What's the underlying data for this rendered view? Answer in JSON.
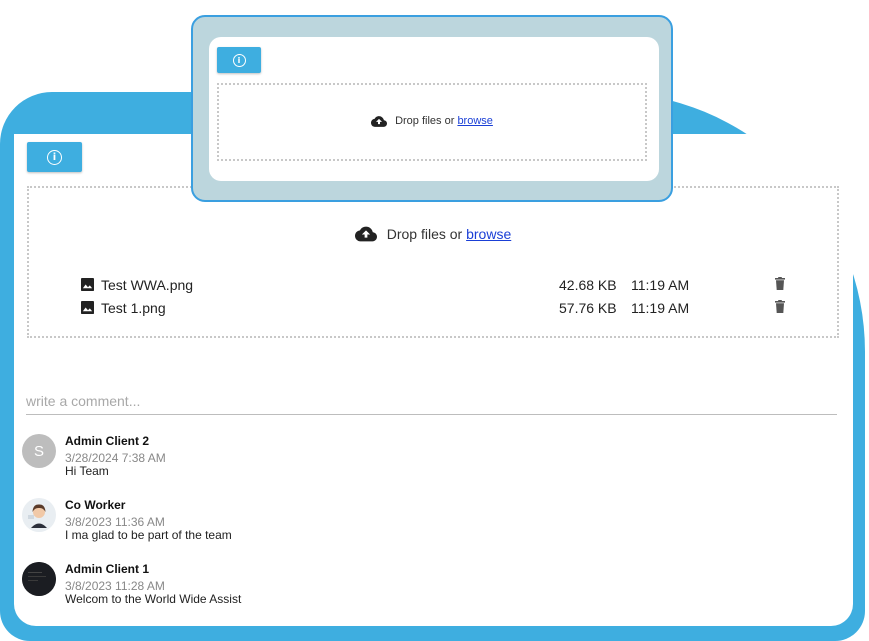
{
  "colors": {
    "accent": "#3eaee0",
    "link": "#1a3fd6",
    "zoom_border": "#3a9fe0"
  },
  "upload": {
    "info_icon": "info-icon",
    "drop_text": "Drop files or",
    "browse_label": "browse",
    "files": [
      {
        "name": "Test WWA.png",
        "size": "42.68 KB",
        "time": "11:19 AM"
      },
      {
        "name": "Test 1.png",
        "size": "57.76 KB",
        "time": "11:19 AM"
      }
    ]
  },
  "comment_box": {
    "placeholder": "write a comment..."
  },
  "comments": [
    {
      "author": "Admin Client 2",
      "initial": "S",
      "date": "3/28/2024 7:38 AM",
      "text": "Hi Team"
    },
    {
      "author": "Co Worker",
      "initial": "",
      "date": "3/8/2023 11:36 AM",
      "text": "I ma glad to be part of the team"
    },
    {
      "author": "Admin Client 1",
      "initial": "",
      "date": "3/8/2023 11:28 AM",
      "text": "Welcom to the World Wide Assist"
    }
  ]
}
